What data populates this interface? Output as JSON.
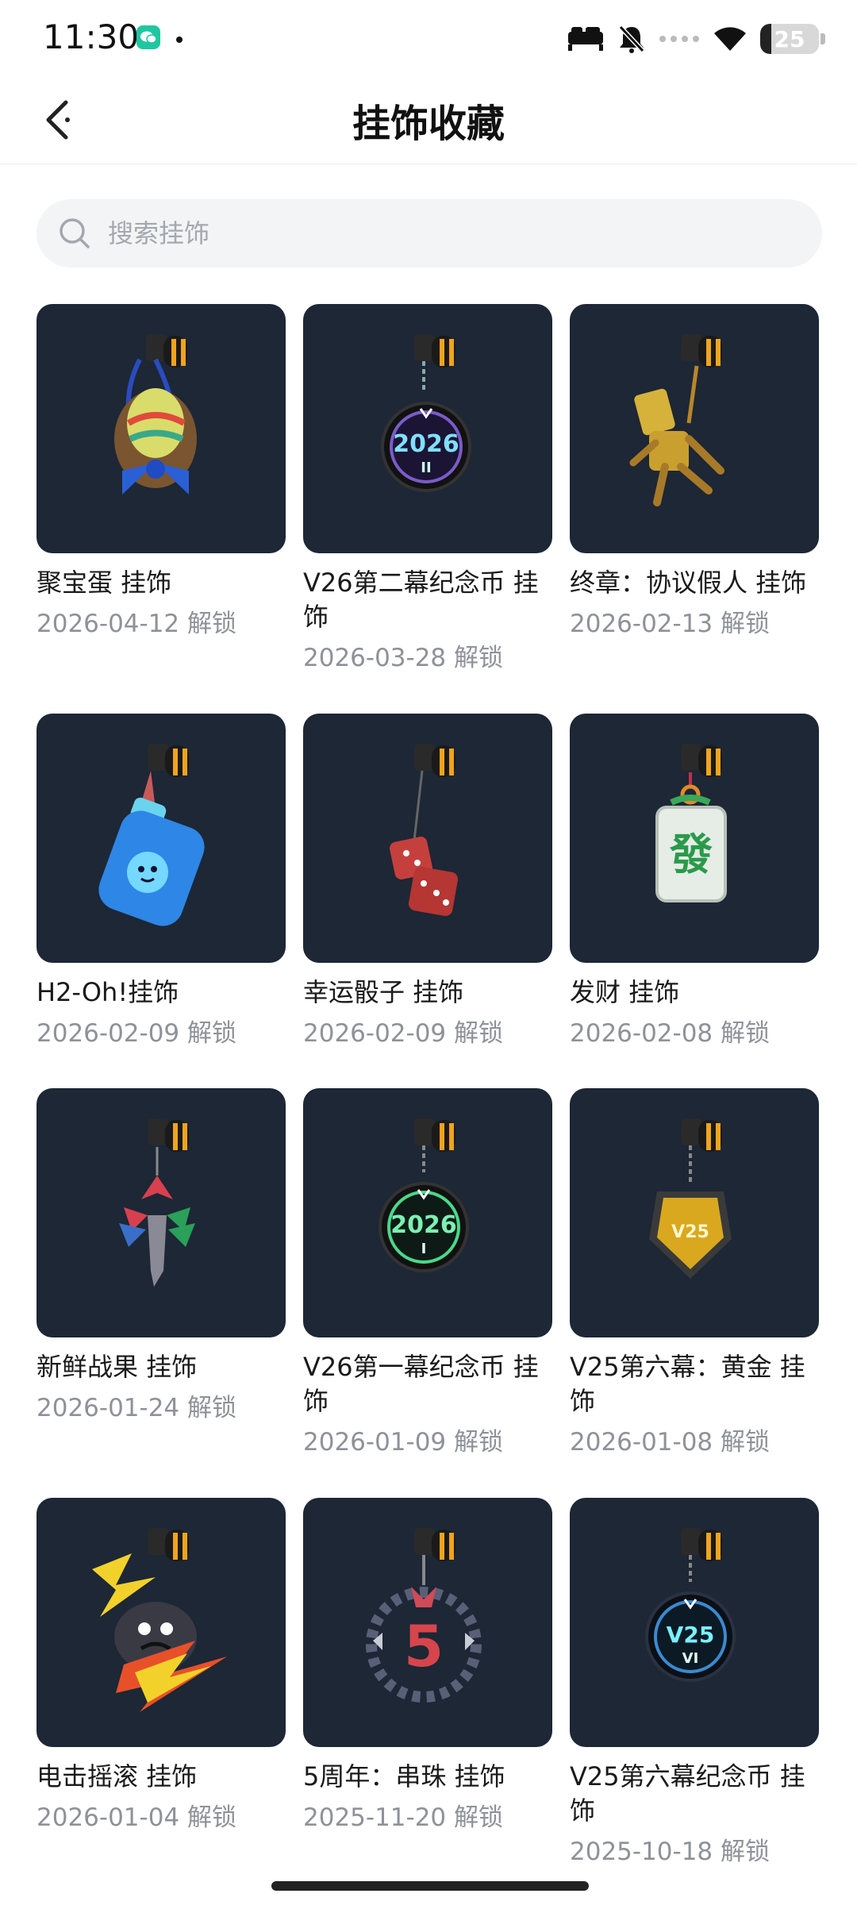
{
  "status": {
    "time": "11:30",
    "battery": "25"
  },
  "header": {
    "title": "挂饰收藏"
  },
  "search": {
    "placeholder": "搜索挂饰",
    "value": ""
  },
  "items": [
    {
      "name": "聚宝蛋 挂饰",
      "date": "2026-04-12 解锁",
      "icon": "easter-egg-basket-charm"
    },
    {
      "name": "V26第二幕纪念币 挂饰",
      "date": "2026-03-28 解锁",
      "icon": "v26-act-2-coin-charm",
      "coin_text": "2026",
      "coin_sub": "II"
    },
    {
      "name": "终章：协议假人 挂饰",
      "date": "2026-02-13 解锁",
      "icon": "golden-dummy-charm"
    },
    {
      "name": "H2-Oh!挂饰",
      "date": "2026-02-09 解锁",
      "icon": "water-bottle-charm"
    },
    {
      "name": "幸运骰子 挂饰",
      "date": "2026-02-09 解锁",
      "icon": "dice-charm"
    },
    {
      "name": "发财 挂饰",
      "date": "2026-02-08 解锁",
      "icon": "mahjong-tile-charm",
      "tile_text": "發"
    },
    {
      "name": "新鲜战果 挂饰",
      "date": "2026-01-24 解锁",
      "icon": "leaf-sprig-charm"
    },
    {
      "name": "V26第一幕纪念币 挂饰",
      "date": "2026-01-09 解锁",
      "icon": "v26-act-1-coin-charm",
      "coin_text": "2026",
      "coin_sub": "I"
    },
    {
      "name": "V25第六幕：黄金 挂饰",
      "date": "2026-01-08 解锁",
      "icon": "gold-shield-charm",
      "shield_text": "V25"
    },
    {
      "name": "电击摇滚 挂饰",
      "date": "2026-01-04 解锁",
      "icon": "electric-rock-charm"
    },
    {
      "name": "5周年：串珠 挂饰",
      "date": "2025-11-20 解锁",
      "icon": "bead-ring-5th-anniversary-charm",
      "ring_text": "5"
    },
    {
      "name": "V25第六幕纪念币 挂饰",
      "date": "2025-10-18 解锁",
      "icon": "v25-act-6-coin-charm",
      "coin_text": "V25",
      "coin_sub": "VI"
    }
  ],
  "colors": {
    "card_bg": "#1d2735",
    "accent_gold": "#f0a41e"
  }
}
